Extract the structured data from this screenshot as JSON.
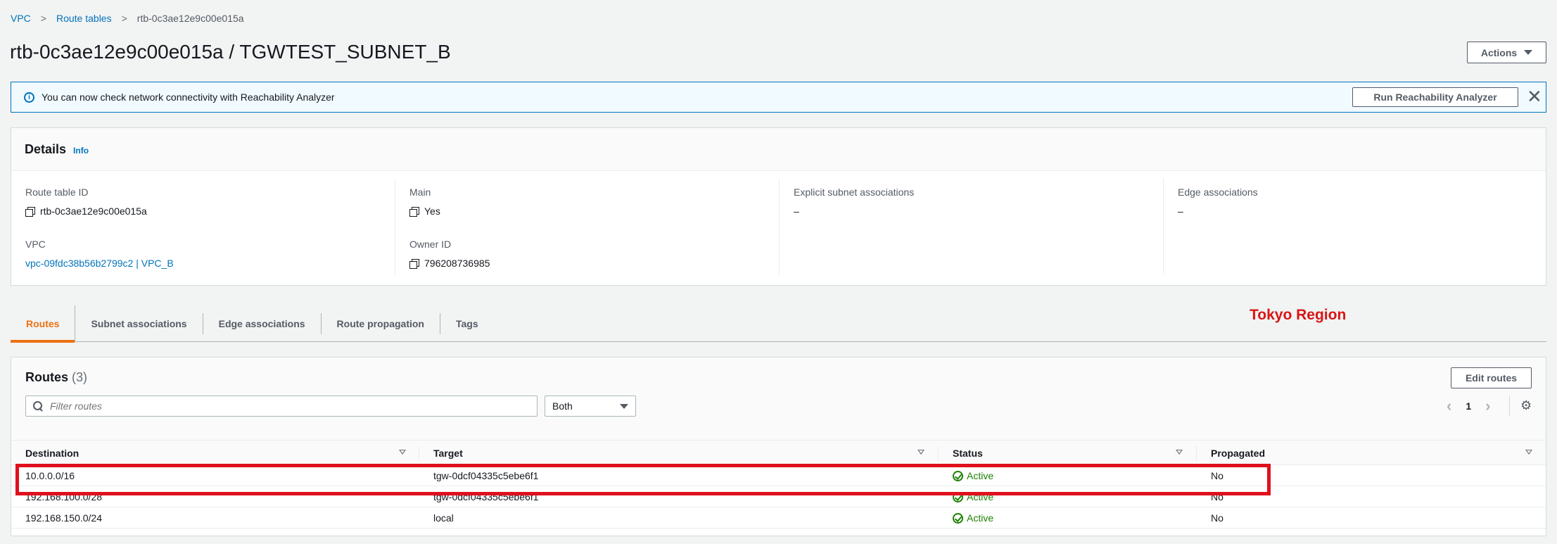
{
  "breadcrumb": {
    "items": [
      "VPC",
      "Route tables"
    ],
    "current": "rtb-0c3ae12e9c00e015a"
  },
  "header": {
    "title": "rtb-0c3ae12e9c00e015a / TGWTEST_SUBNET_B",
    "actions_label": "Actions"
  },
  "flash": {
    "message": "You can now check network connectivity with Reachability Analyzer",
    "button_label": "Run Reachability Analyzer",
    "close": "✕"
  },
  "details": {
    "title": "Details",
    "info_label": "Info",
    "route_table_id_label": "Route table ID",
    "route_table_id": "rtb-0c3ae12e9c00e015a",
    "vpc_label": "VPC",
    "vpc_value": "vpc-09fdc38b56b2799c2 | VPC_B",
    "main_label": "Main",
    "main_value": "Yes",
    "owner_label": "Owner ID",
    "owner_value": "796208736985",
    "explicit_label": "Explicit subnet associations",
    "explicit_value": "–",
    "edge_label": "Edge associations",
    "edge_value": "–"
  },
  "tabs": [
    "Routes",
    "Subnet associations",
    "Edge associations",
    "Route propagation",
    "Tags"
  ],
  "annotation": {
    "text": "Tokyo Region",
    "color": "#d91515"
  },
  "routes": {
    "title": "Routes",
    "count": "(3)",
    "edit_label": "Edit routes",
    "search_placeholder": "Filter routes",
    "filter_value": "Both",
    "page": "1",
    "prev": "‹",
    "next": "›",
    "gear": "⚙",
    "columns": [
      "Destination",
      "Target",
      "Status",
      "Propagated"
    ],
    "rows": [
      {
        "destination": "10.0.0.0/16",
        "target": "tgw-0dcf04335c5ebe6f1",
        "status": "Active",
        "propagated": "No"
      },
      {
        "destination": "192.168.100.0/28",
        "target": "tgw-0dcf04335c5ebe6f1",
        "status": "Active",
        "propagated": "No"
      },
      {
        "destination": "192.168.150.0/24",
        "target": "local",
        "status": "Active",
        "propagated": "No"
      }
    ]
  },
  "colors": {
    "accent": "#ec7211",
    "link": "#0073bb",
    "success": "#1d8102",
    "highlight": "#e0101e"
  }
}
